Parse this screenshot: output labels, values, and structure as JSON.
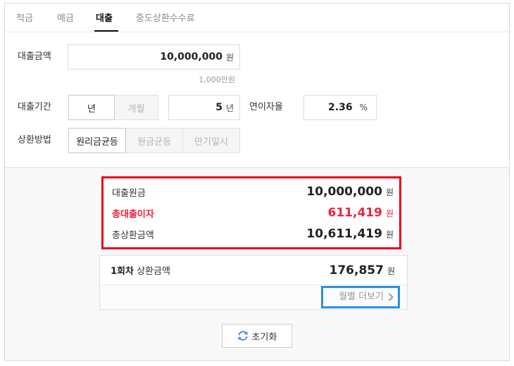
{
  "tabs": [
    {
      "label": "적금",
      "active": false
    },
    {
      "label": "예금",
      "active": false
    },
    {
      "label": "대출",
      "active": true
    },
    {
      "label": "중도상환수수료",
      "active": false
    }
  ],
  "form": {
    "amount": {
      "label": "대출금액",
      "value": "10,000,000",
      "unit": "원",
      "helper": "1,000만원"
    },
    "period": {
      "label": "대출기간",
      "unit_options": [
        {
          "label": "년",
          "selected": true
        },
        {
          "label": "개월",
          "selected": false
        }
      ],
      "value": "5",
      "value_unit": "년"
    },
    "rate": {
      "label": "연이자율",
      "value": "2.36",
      "unit": "%"
    },
    "method": {
      "label": "상환방법",
      "options": [
        {
          "label": "원리금균등",
          "selected": true
        },
        {
          "label": "원금균등",
          "selected": false
        },
        {
          "label": "만기일시",
          "selected": false
        }
      ]
    }
  },
  "summary": {
    "rows": [
      {
        "label": "대출원금",
        "value": "10,000,000",
        "unit": "원"
      },
      {
        "label": "총대출이자",
        "value": "611,419",
        "unit": "원"
      },
      {
        "label": "총상환금액",
        "value": "10,611,419",
        "unit": "원"
      }
    ]
  },
  "installment": {
    "label_bold": "1회차",
    "label": "상환금액",
    "value": "176,857",
    "unit": "원",
    "more_label": "월별 더보기",
    "more_icon": "chevron-right-icon"
  },
  "reset": {
    "label": "초기화",
    "icon": "refresh-icon"
  },
  "colors": {
    "accent_red": "#f3213a",
    "annotation_red": "#e8001c",
    "annotation_blue": "#2b8fdd",
    "icon_blue": "#3a8ee6"
  }
}
